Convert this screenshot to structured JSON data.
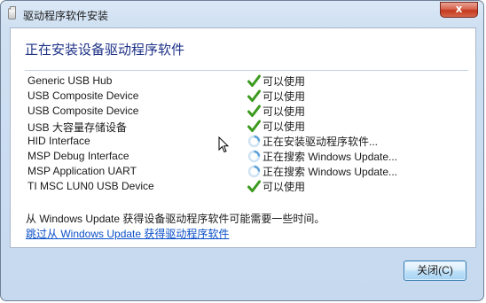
{
  "window": {
    "title": "驱动程序软件安装",
    "close_glyph": "x"
  },
  "heading": "正在安装设备驱动程序软件",
  "devices": [
    {
      "name": "Generic USB Hub",
      "status": "可以使用",
      "icon": "check-icon"
    },
    {
      "name": "USB Composite Device",
      "status": "可以使用",
      "icon": "check-icon"
    },
    {
      "name": "USB Composite Device",
      "status": "可以使用",
      "icon": "check-icon"
    },
    {
      "name": "USB 大容量存储设备",
      "status": "可以使用",
      "icon": "check-icon"
    },
    {
      "name": "HID Interface",
      "status": "正在安装驱动程序软件...",
      "icon": "spinner-icon"
    },
    {
      "name": "MSP Debug Interface",
      "status": "正在搜索 Windows Update...",
      "icon": "spinner-icon"
    },
    {
      "name": "MSP Application UART",
      "status": "正在搜索 Windows Update...",
      "icon": "spinner-icon"
    },
    {
      "name": "TI MSC LUN0 USB Device",
      "status": "可以使用",
      "icon": "check-icon"
    }
  ],
  "note": "从 Windows Update 获得设备驱动程序软件可能需要一些时间。",
  "skip_link": "跳过从 Windows Update 获得驱动程序软件",
  "close_button": "关闭(C)",
  "colors": {
    "heading": "#1e3287",
    "link": "#0a4fc8",
    "check": "#3c9a1e",
    "spinner": "#5aa0d8"
  }
}
